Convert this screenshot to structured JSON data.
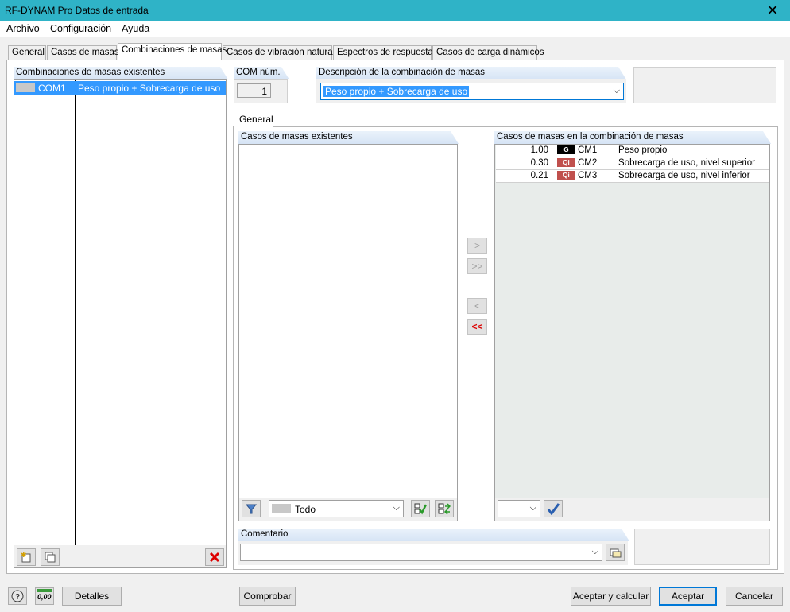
{
  "window": {
    "title": "RF-DYNAM Pro Datos de entrada",
    "close_glyph": "✕"
  },
  "menu": [
    "Archivo",
    "Configuración",
    "Ayuda"
  ],
  "tabs": [
    "General",
    "Casos de masas",
    "Combinaciones de masas",
    "Casos de vibración natural",
    "Espectros de respuesta",
    "Casos de carga dinámicos"
  ],
  "active_tab": "Combinaciones de masas",
  "existing_combinations": {
    "header": "Combinaciones de masas existentes",
    "items": [
      {
        "id": "COM1",
        "description": "Peso propio + Sobrecarga de uso",
        "selected": true
      }
    ]
  },
  "com_number": {
    "label": "COM núm.",
    "value": "1"
  },
  "description": {
    "label": "Descripción de la combinación de masas",
    "value": "Peso propio + Sobrecarga de uso"
  },
  "inner_tab": "General",
  "existing_mass_cases": {
    "header": "Casos de masas existentes",
    "filter_value": "Todo"
  },
  "mass_cases_in_combination": {
    "header": "Casos de masas en la combinación de masas",
    "rows": [
      {
        "factor": "1.00",
        "badge": "G",
        "badge_color": "#000000",
        "case": "CM1",
        "description": "Peso propio"
      },
      {
        "factor": "0.30",
        "badge": "Qi",
        "badge_color": "#c0504d",
        "case": "CM2",
        "description": "Sobrecarga de uso, nivel superior"
      },
      {
        "factor": "0.21",
        "badge": "Qi",
        "badge_color": "#c0504d",
        "case": "CM3",
        "description": "Sobrecarga de uso, nivel inferior"
      }
    ]
  },
  "arrows": {
    "add": ">",
    "add_all": ">>",
    "remove": "<",
    "remove_all": "<<"
  },
  "comment": {
    "label": "Comentario",
    "value": ""
  },
  "footer": {
    "details": "Detalles",
    "check": "Comprobar",
    "accept_calc": "Aceptar y calcular",
    "accept": "Aceptar",
    "cancel": "Cancelar",
    "units_glyph": "0,00"
  },
  "colors": {
    "titlebar": "#2fb3c7",
    "selection": "#3399ff",
    "accent": "#0078d7"
  }
}
